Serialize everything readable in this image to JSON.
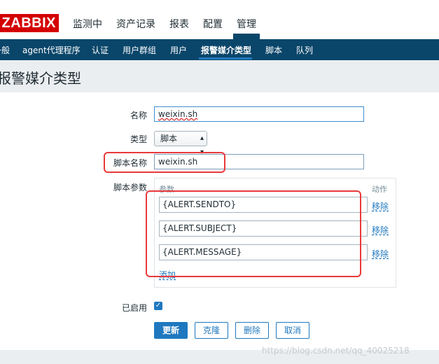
{
  "logo": "ZABBIX",
  "main_nav": [
    {
      "label": "监测中"
    },
    {
      "label": "资产记录"
    },
    {
      "label": "报表"
    },
    {
      "label": "配置"
    },
    {
      "label": "管理"
    }
  ],
  "sub_nav": [
    {
      "label": "一般"
    },
    {
      "label": "agent代理程序"
    },
    {
      "label": "认证"
    },
    {
      "label": "用户群组"
    },
    {
      "label": "用户"
    },
    {
      "label": "报警媒介类型"
    },
    {
      "label": "脚本"
    },
    {
      "label": "队列"
    }
  ],
  "page_title": "报警媒介类型",
  "form": {
    "name_label": "名称",
    "name_value": "weixin.sh",
    "type_label": "类型",
    "type_value": "脚本",
    "script_name_label": "脚本名称",
    "script_name_value": "weixin.sh",
    "script_params_label": "脚本参数",
    "params_col_header": "参数",
    "action_col_header": "动作",
    "params": [
      {
        "value": "{ALERT.SENDTO}",
        "action": "移除"
      },
      {
        "value": "{ALERT.SUBJECT}",
        "action": "移除"
      },
      {
        "value": "{ALERT.MESSAGE}",
        "action": "移除"
      }
    ],
    "add_label": "添加",
    "enabled_label": "已启用",
    "enabled": true
  },
  "buttons": {
    "update": "更新",
    "clone": "克隆",
    "delete": "删除",
    "cancel": "取消"
  },
  "watermark": "https://blog.csdn.net/qq_40025218",
  "colors": {
    "brand_red": "#d40000",
    "nav_dark": "#0a466a",
    "accent_blue": "#1f78bf",
    "highlight_red": "#e8393a"
  }
}
